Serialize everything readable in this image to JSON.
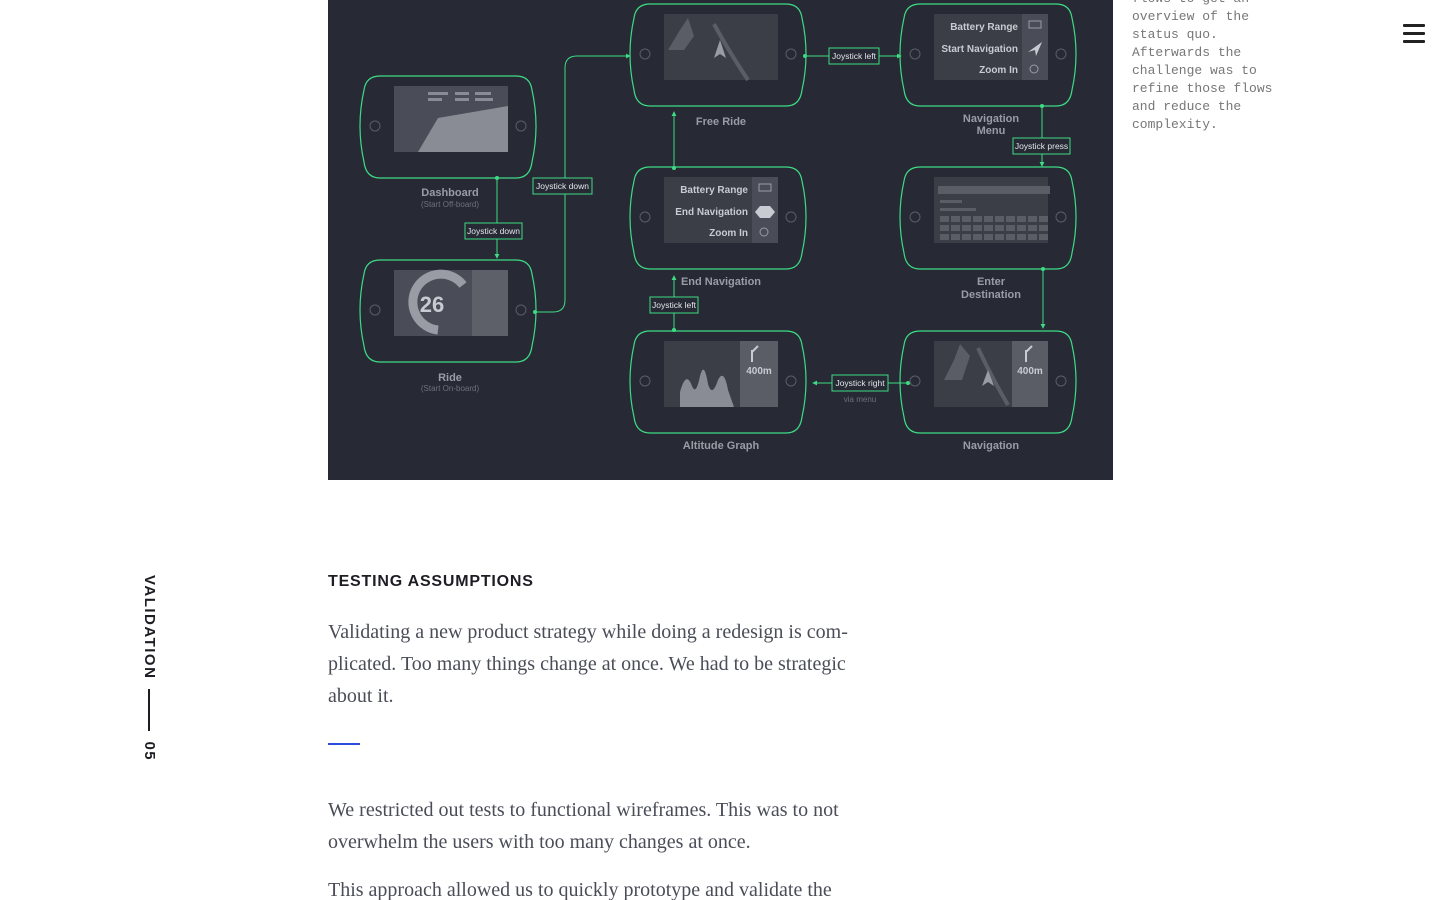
{
  "header": {
    "menu_icon": "hamburger-menu-icon"
  },
  "side_note": {
    "text": "flows to get an overview of the status quo. Afterwards the challenge was to refine those flows and reduce the complexity."
  },
  "diagram": {
    "colors": {
      "background": "#272a35",
      "outline": "#3ddc84",
      "screen": "#4a4c57",
      "label": "#9a9ca5"
    },
    "screens": {
      "dashboard": {
        "title": "Dashboard",
        "subtitle": "(Start Off-board)"
      },
      "ride": {
        "title": "Ride",
        "subtitle": "(Start On-board)",
        "speed": "26"
      },
      "free_ride": {
        "title": "Free Ride"
      },
      "navigation_menu": {
        "title_line1": "Navigation",
        "title_line2": "Menu",
        "items": [
          "Battery Range",
          "Start Navigation",
          "Zoom In"
        ]
      },
      "end_navigation": {
        "title": "End Navigation",
        "items": [
          "Battery Range",
          "End Navigation",
          "Zoom In"
        ]
      },
      "enter_destination": {
        "title_line1": "Enter",
        "title_line2": "Destination"
      },
      "altitude_graph": {
        "title": "Altitude Graph",
        "distance": "400m"
      },
      "navigation": {
        "title": "Navigation",
        "distance": "400m"
      }
    },
    "actions": {
      "dash_to_ride": "Joystick down",
      "ride_to_free": "Joystick down",
      "free_to_navmenu": "Joystick left",
      "navmenu_to_dest": "Joystick press",
      "nav_to_altitude": "Joystick right",
      "nav_to_altitude_sub": "via menu",
      "altitude_to_end": "Joystick left"
    }
  },
  "section": {
    "label": "VALIDATION",
    "number": "05"
  },
  "content": {
    "heading": "TESTING ASSUMPTIONS",
    "paragraph1": "Validating a new product strategy while doing a redesign is com-plicated. Too many things change at once. We had to be strategic about it.",
    "paragraph2": "We restricted out tests to functional wireframes. This was to not overwhelm the users with too many changes at once.",
    "paragraph3": "This approach allowed us to quickly prototype and validate the"
  }
}
